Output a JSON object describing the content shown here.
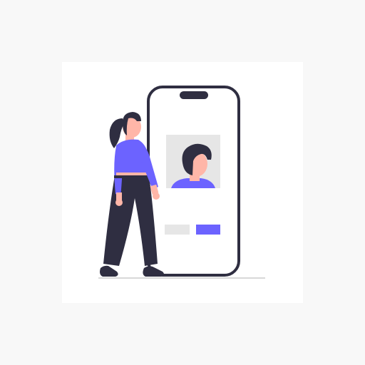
{
  "colors": {
    "background": "#f8f8f8",
    "card": "#ffffff",
    "outline": "#2f2e41",
    "accent": "#6c63ff",
    "skin": "#ffb6a8",
    "hair": "#2f2e41",
    "photo_bg": "#e6e6e6",
    "secondary_button": "#e6e6e6",
    "ground": "#cccccc"
  },
  "icons": {
    "phone": "smartphone-icon",
    "profile": "user-avatar-icon",
    "person": "woman-illustration"
  }
}
